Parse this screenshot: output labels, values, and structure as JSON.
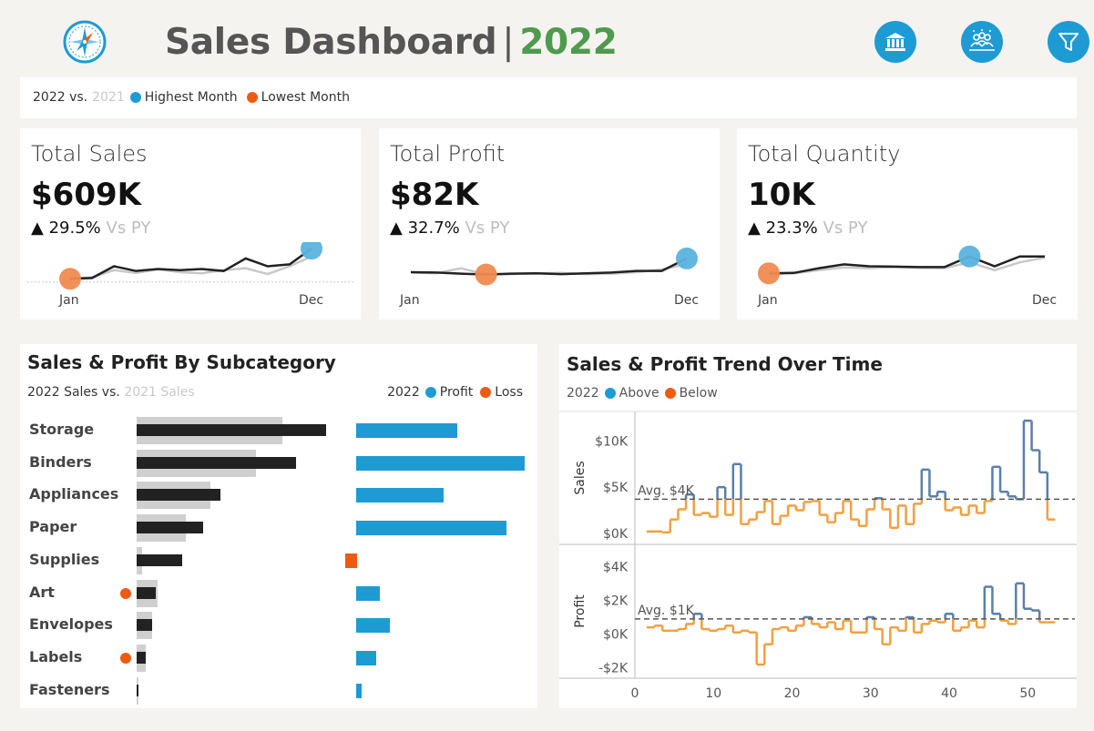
{
  "header": {
    "title": "Sales Dashboard",
    "separator": "|",
    "year": "2022",
    "buttons": [
      {
        "icon": "bank-icon"
      },
      {
        "icon": "people-icon"
      },
      {
        "icon": "filter-icon"
      }
    ]
  },
  "legend": {
    "current": "2022 vs.",
    "previous": "2021",
    "highest": "Highest Month",
    "lowest": "Lowest Month"
  },
  "colors": {
    "accent_blue": "#1e9bd2",
    "accent_orange": "#ef5a13",
    "title_green": "#4e9a4e",
    "line_dark": "#222222",
    "line_grey": "#c8c8c8",
    "trend_blue": "#5b7fa8",
    "trend_orange": "#f0a040"
  },
  "kpis": [
    {
      "title": "Total Sales",
      "value": "$609K",
      "change": "29.5%",
      "vs": "Vs PY",
      "start_label": "Jan",
      "end_label": "Dec",
      "current": [
        0.18,
        0.2,
        0.5,
        0.38,
        0.43,
        0.4,
        0.43,
        0.38,
        0.7,
        0.5,
        0.55,
        0.95
      ],
      "previous": [
        0.18,
        0.22,
        0.4,
        0.33,
        0.42,
        0.35,
        0.32,
        0.4,
        0.45,
        0.3,
        0.5,
        0.75
      ]
    },
    {
      "title": "Total Profit",
      "value": "$82K",
      "change": "32.7%",
      "vs": "Vs PY",
      "start_label": "Jan",
      "end_label": "Dec",
      "current": [
        0.35,
        0.34,
        0.31,
        0.29,
        0.31,
        0.32,
        0.3,
        0.32,
        0.34,
        0.38,
        0.38,
        0.7
      ],
      "previous": [
        0.34,
        0.32,
        0.45,
        0.29,
        0.3,
        0.32,
        0.33,
        0.3,
        0.31,
        0.35,
        0.42,
        0.55
      ]
    },
    {
      "title": "Total Quantity",
      "value": "10K",
      "change": "23.3%",
      "vs": "Vs PY",
      "start_label": "Jan",
      "end_label": "Dec",
      "current": [
        0.32,
        0.33,
        0.45,
        0.55,
        0.5,
        0.49,
        0.48,
        0.48,
        0.75,
        0.5,
        0.75,
        0.75
      ],
      "previous": [
        0.3,
        0.32,
        0.4,
        0.47,
        0.45,
        0.48,
        0.46,
        0.45,
        0.6,
        0.4,
        0.6,
        0.72
      ]
    }
  ],
  "subcategory": {
    "title": "Sales & Profit By Subcategory",
    "left_label_current": "2022 Sales vs.",
    "left_label_previous": "2021 Sales",
    "right_label_year": "2022",
    "right_label_profit": "Profit",
    "right_label_loss": "Loss",
    "rows": [
      {
        "name": "Storage",
        "sales_2022": 1.0,
        "sales_2021": 0.77,
        "profit": 0.6,
        "loss_dot": false
      },
      {
        "name": "Binders",
        "sales_2022": 0.84,
        "sales_2021": 0.63,
        "profit": 1.0,
        "loss_dot": false
      },
      {
        "name": "Appliances",
        "sales_2022": 0.44,
        "sales_2021": 0.39,
        "profit": 0.52,
        "loss_dot": false
      },
      {
        "name": "Paper",
        "sales_2022": 0.35,
        "sales_2021": 0.26,
        "profit": 0.89,
        "loss_dot": false
      },
      {
        "name": "Supplies",
        "sales_2022": 0.24,
        "sales_2021": 0.03,
        "profit": -0.07,
        "loss_dot": false
      },
      {
        "name": "Art",
        "sales_2022": 0.1,
        "sales_2021": 0.11,
        "profit": 0.14,
        "loss_dot": true
      },
      {
        "name": "Envelopes",
        "sales_2022": 0.08,
        "sales_2021": 0.08,
        "profit": 0.2,
        "loss_dot": false
      },
      {
        "name": "Labels",
        "sales_2022": 0.05,
        "sales_2021": 0.05,
        "profit": 0.12,
        "loss_dot": true
      },
      {
        "name": "Fasteners",
        "sales_2022": 0.01,
        "sales_2021": 0.01,
        "profit": 0.03,
        "loss_dot": false
      }
    ]
  },
  "trend": {
    "title": "Sales & Profit Trend Over Time",
    "legend_year": "2022",
    "legend_above": "Above",
    "legend_below": "Below",
    "sales_axis_label": "Sales",
    "profit_axis_label": "Profit",
    "sales_ticks": [
      "$10K",
      "$5K",
      "$0K"
    ],
    "profit_ticks": [
      "$4K",
      "$2K",
      "$0K",
      "-$2K"
    ],
    "sales_avg_label": "Avg. $4K",
    "profit_avg_label": "Avg. $1K",
    "x_ticks": [
      "0",
      "10",
      "20",
      "30",
      "40",
      "50"
    ]
  },
  "chart_data": {
    "type": "line",
    "x": [
      2,
      3,
      4,
      5,
      6,
      7,
      8,
      9,
      10,
      11,
      12,
      13,
      14,
      15,
      16,
      17,
      18,
      19,
      20,
      21,
      22,
      23,
      24,
      25,
      26,
      27,
      28,
      29,
      30,
      31,
      32,
      33,
      34,
      35,
      36,
      37,
      38,
      39,
      40,
      41,
      42,
      43,
      44,
      45,
      46,
      47,
      48,
      49,
      50,
      51,
      52,
      53
    ],
    "series": [
      {
        "name": "Sales",
        "values": [
          0.2,
          0.2,
          0.1,
          1.5,
          2.6,
          4.2,
          2.0,
          2.2,
          1.8,
          5.0,
          2.0,
          7.5,
          1.0,
          1.5,
          2.3,
          3.5,
          1.0,
          1.9,
          3.0,
          2.5,
          3.4,
          3.5,
          2.0,
          1.2,
          2.2,
          3.5,
          1.5,
          0.8,
          2.6,
          3.8,
          2.6,
          0.6,
          3.0,
          1.0,
          3.2,
          6.9,
          4.0,
          4.5,
          2.5,
          2.8,
          2.0,
          3.0,
          2.2,
          3.5,
          7.2,
          4.5,
          4.0,
          3.7,
          12.2,
          9.0,
          6.6,
          1.5
        ]
      },
      {
        "name": "Profit",
        "values": [
          0.4,
          0.5,
          0.2,
          0.2,
          0.3,
          0.6,
          1.2,
          0.3,
          0.2,
          0.3,
          0.5,
          0.1,
          0.2,
          0.1,
          -1.8,
          -0.6,
          0.3,
          0.4,
          0.2,
          0.5,
          1.0,
          0.6,
          0.4,
          0.7,
          0.3,
          0.8,
          0.1,
          0.1,
          1.0,
          0.3,
          -0.6,
          0.4,
          0.2,
          1.0,
          0.1,
          0.6,
          0.8,
          0.7,
          1.2,
          0.2,
          0.4,
          0.8,
          0.4,
          2.8,
          1.2,
          0.8,
          0.6,
          3.0,
          1.5,
          1.4,
          0.7,
          0.7
        ]
      }
    ],
    "sales_ylim": [
      -1,
      13
    ],
    "profit_ylim": [
      -2.5,
      5.2
    ],
    "sales_avg": 3.7,
    "profit_avg": 0.9,
    "xlim": [
      0,
      56
    ]
  }
}
